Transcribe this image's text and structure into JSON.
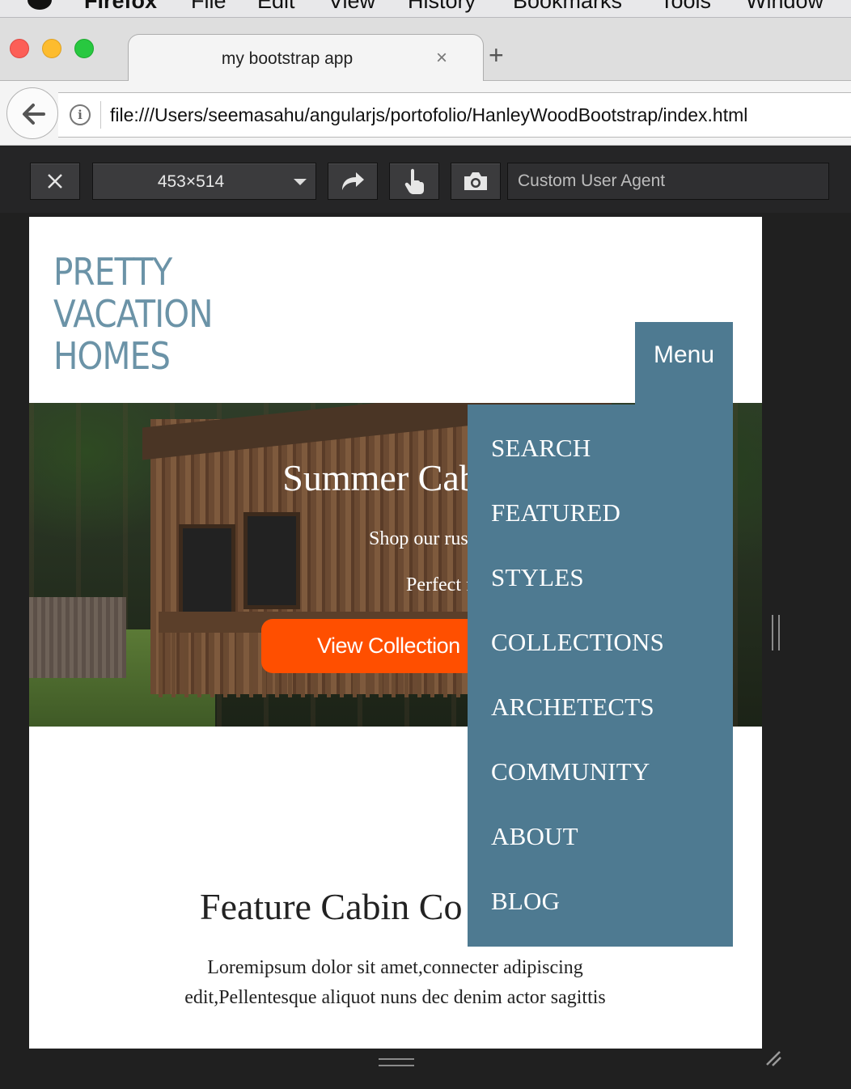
{
  "os_menubar": {
    "items": [
      "Firefox",
      "File",
      "Edit",
      "View",
      "History",
      "Bookmarks",
      "Tools",
      "Window"
    ]
  },
  "browser": {
    "tab_title": "my bootstrap app",
    "tab_close": "×",
    "new_tab": "+",
    "url": "file:///Users/seemasahu/angularjs/portofolio/HanleyWoodBootstrap/index.html",
    "info_glyph": "i"
  },
  "rdm_toolbar": {
    "close_glyph": "×",
    "viewport_size": "453×514",
    "user_agent_placeholder": "Custom User Agent"
  },
  "site": {
    "logo_lines": [
      "PRETTY",
      "VACATION",
      "HOMES"
    ],
    "menu_button": "Menu",
    "hero_title": "Summer Cabin C",
    "hero_line1": "Shop our rustically modern cal",
    "hero_line2": "Perfect for a wooded plotor ",
    "cta_label": "View Collection",
    "section_title": "Feature Cabin Co",
    "section_text": "Loremipsum dolor sit amet,connecter adipiscing edit,Pellentesque aliquot nuns dec denim actor sagittis",
    "nav_items": [
      "SEARCH",
      "FEATURED",
      "STYLES",
      "COLLECTIONS",
      "ARCHETECTS",
      "COMMUNITY",
      "ABOUT",
      "BLOG"
    ]
  },
  "colors": {
    "accent": "#4e7a91",
    "cta": "#ff4f00",
    "logo": "#6b93a7"
  }
}
